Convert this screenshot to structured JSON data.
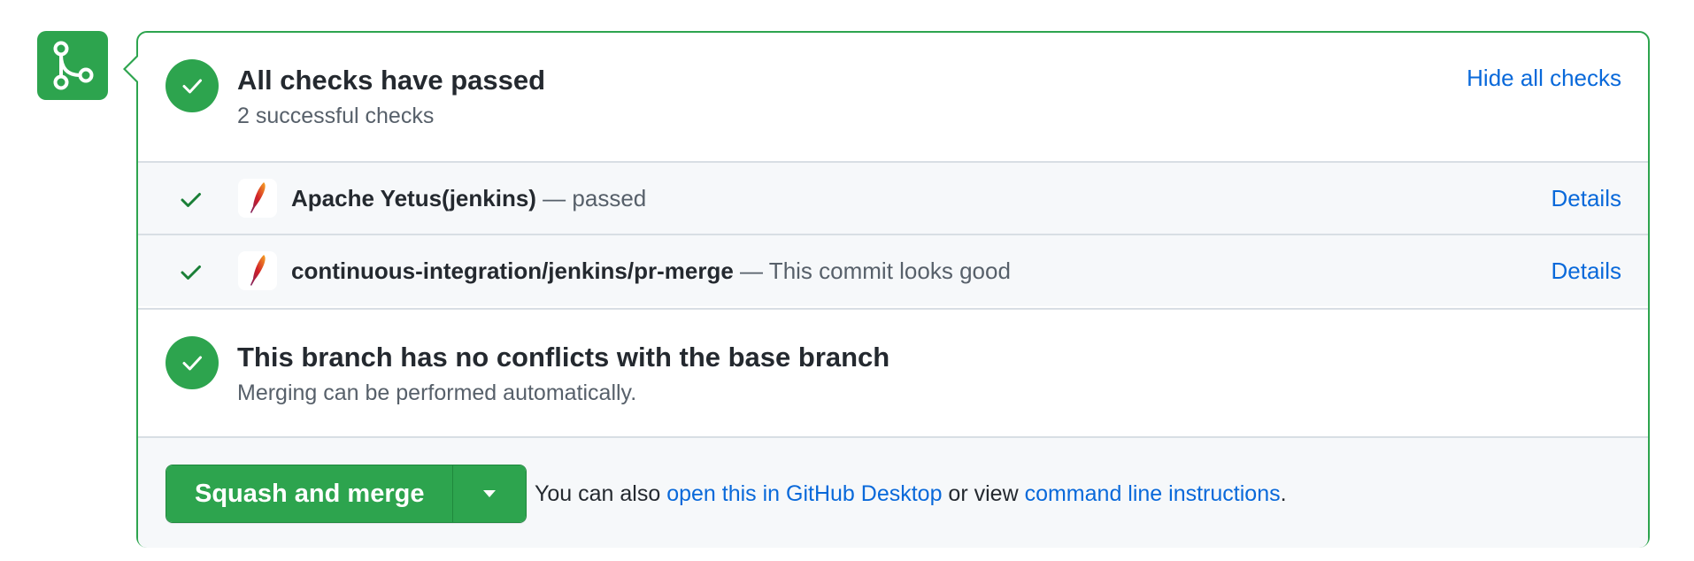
{
  "icons": {
    "merge": "git-merge-icon",
    "check": "check-icon",
    "app": "apache-feather-icon",
    "dropdown": "triangle-down-icon"
  },
  "colors": {
    "success": "#2da44e",
    "link": "#0969da",
    "muted": "#57606a"
  },
  "checks_summary": {
    "title": "All checks have passed",
    "subtitle": "2 successful checks",
    "toggle_link": "Hide all checks"
  },
  "checks": [
    {
      "name": "Apache Yetus(jenkins)",
      "description": " — passed",
      "details_label": "Details"
    },
    {
      "name": "continuous-integration/jenkins/pr-merge",
      "description": " — This commit looks good",
      "details_label": "Details"
    }
  ],
  "conflicts": {
    "title": "This branch has no conflicts with the base branch",
    "subtitle": "Merging can be performed automatically."
  },
  "merge": {
    "button_label": "Squash and merge",
    "hint_prefix": "You can also ",
    "desktop_link": "open this in GitHub Desktop",
    "hint_middle": " or view ",
    "cli_link": "command line instructions",
    "hint_suffix": "."
  }
}
